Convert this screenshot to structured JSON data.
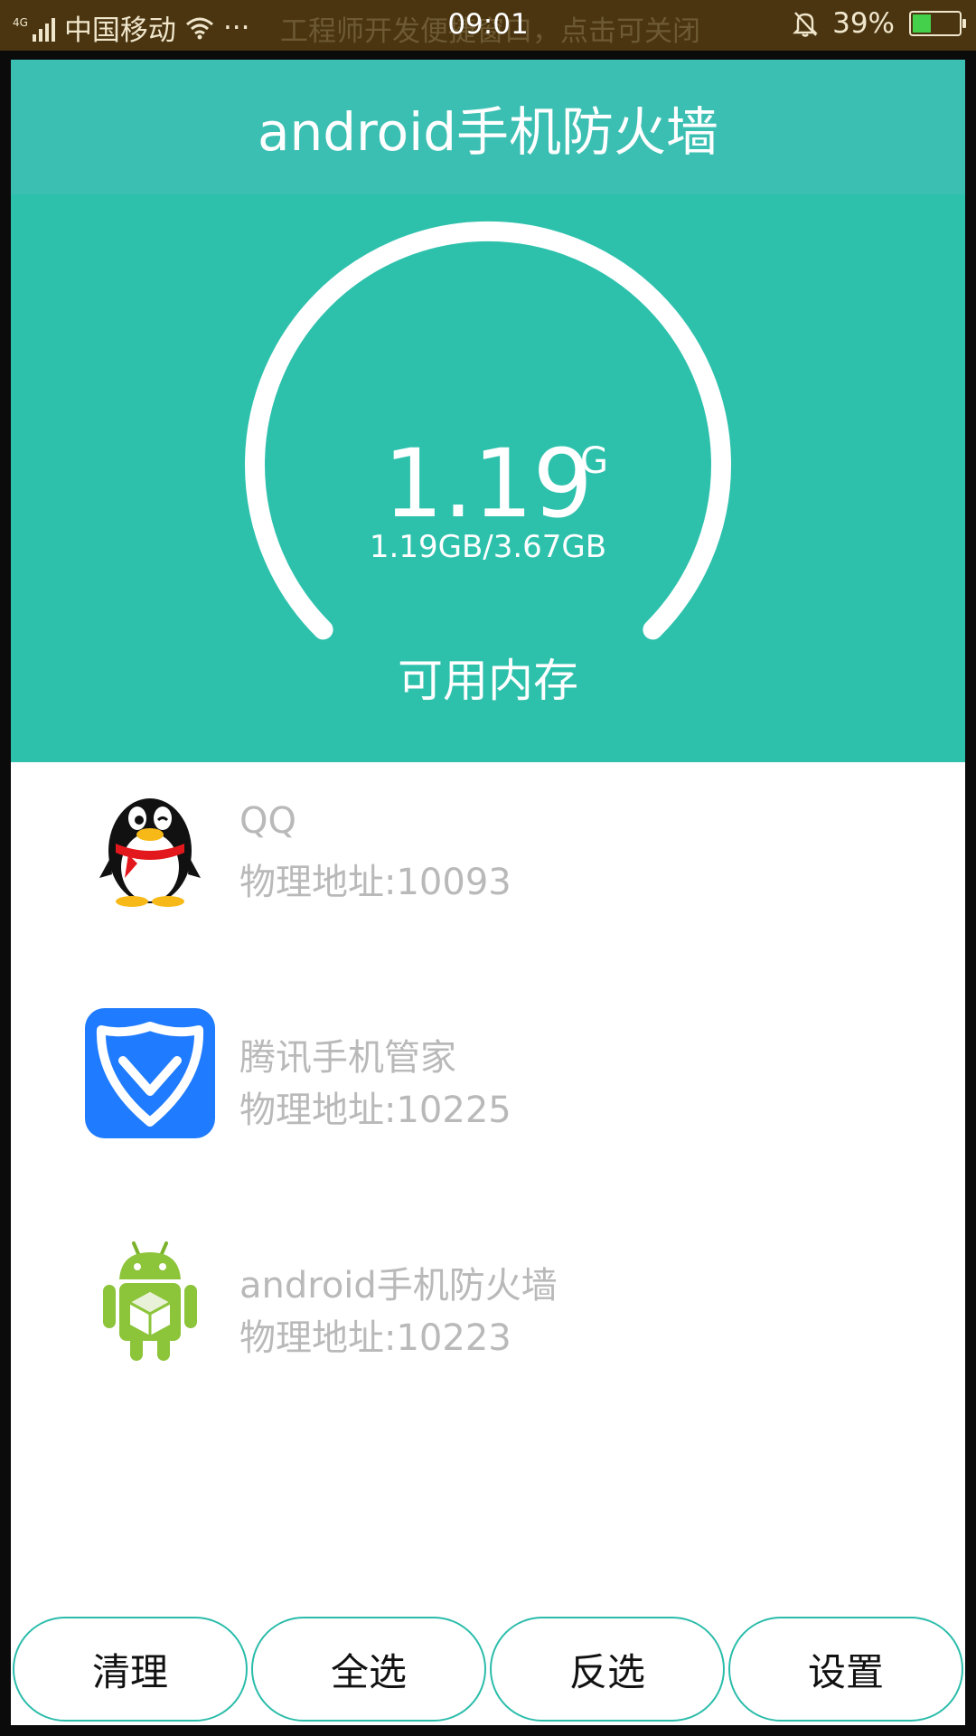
{
  "status_bar": {
    "network": "4G",
    "carrier": "中国移动",
    "more": "···",
    "notice": "工程师开发便捷窗口，点击可关闭",
    "time": "09:01",
    "battery": "39%",
    "battery_level": 0.39
  },
  "header": {
    "title": "android手机防火墙"
  },
  "memory": {
    "value": "1.19",
    "unit": "G",
    "detail": "1.19GB/3.67GB",
    "label": "可用内存",
    "ratio": 0.32
  },
  "apps": [
    {
      "name": "QQ",
      "address": "物理地址:10093",
      "icon": "qq-penguin-icon"
    },
    {
      "name": "腾讯手机管家",
      "address": "物理地址:10225",
      "icon": "tencent-manager-icon"
    },
    {
      "name": "android手机防火墙",
      "address": "物理地址:10223",
      "icon": "android-robot-icon"
    }
  ],
  "buttons": {
    "clean": "清理",
    "select_all": "全选",
    "invert": "反选",
    "settings": "设置"
  },
  "colors": {
    "header": "#3bbfb2",
    "gauge_bg": "#2dc1ac",
    "status_bar": "#4a3510",
    "button_border": "#2bbcaa"
  }
}
